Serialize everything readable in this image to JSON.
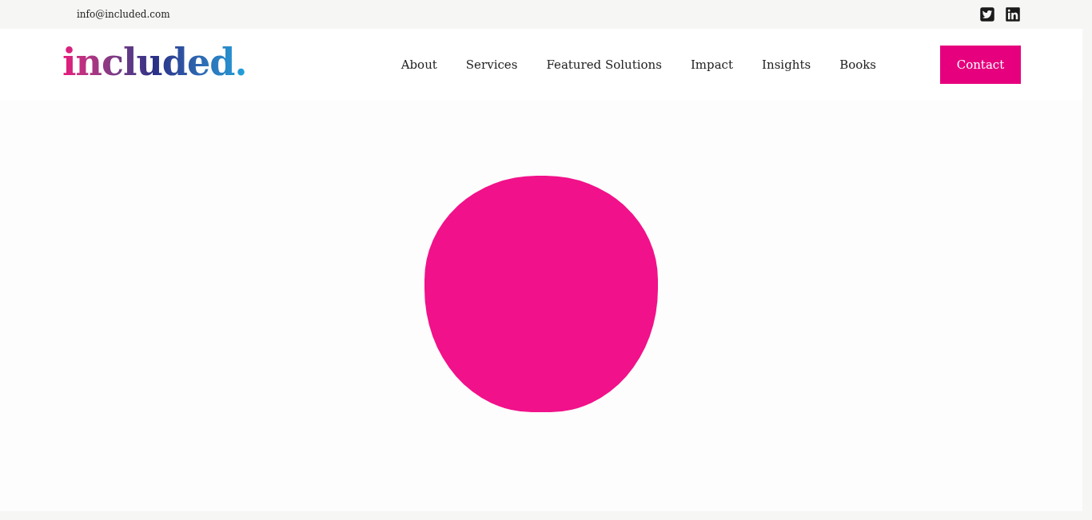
{
  "top_bar": {
    "email": "info@included.com"
  },
  "header": {
    "logo": "included.",
    "nav": [
      {
        "label": "About"
      },
      {
        "label": "Services"
      },
      {
        "label": "Featured Solutions"
      },
      {
        "label": "Impact"
      },
      {
        "label": "Insights"
      },
      {
        "label": "Books"
      }
    ],
    "cta": "Contact"
  }
}
